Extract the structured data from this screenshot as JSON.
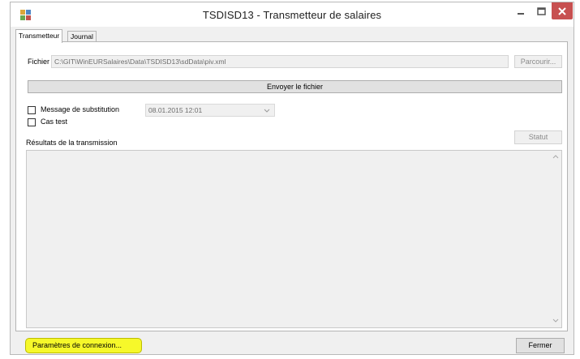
{
  "window": {
    "title": "TSDISD13 - Transmetteur de salaires",
    "controls": {
      "minimize": "–",
      "maximize": "☐",
      "close": "✕"
    },
    "colors": {
      "close_bg": "#c75050",
      "highlight": "#f6f82a"
    }
  },
  "tabs": [
    {
      "label": "Transmetteur",
      "active": true
    },
    {
      "label": "Journal",
      "active": false
    }
  ],
  "file": {
    "label": "Fichier",
    "value": "C:\\GIT\\WinEURSalaires\\Data\\TSDISD13\\sdData\\piv.xml",
    "browse_label": "Parcourir..."
  },
  "send_button_label": "Envoyer le fichier",
  "options": {
    "substitution_label": "Message de substitution",
    "substitution_checked": false,
    "date_value": "08.01.2015 12:01",
    "test_label": "Cas test",
    "test_checked": false
  },
  "results": {
    "label": "Résultats de la transmission",
    "status_label": "Statut"
  },
  "footer": {
    "connection_label": "Paramètres de connexion...",
    "close_label": "Fermer"
  },
  "icons": {
    "app": "app-icon",
    "dropdown": "chevron-down-icon",
    "scroll_up": "scroll-up-arrow-icon",
    "scroll_down": "scroll-down-arrow-icon"
  }
}
